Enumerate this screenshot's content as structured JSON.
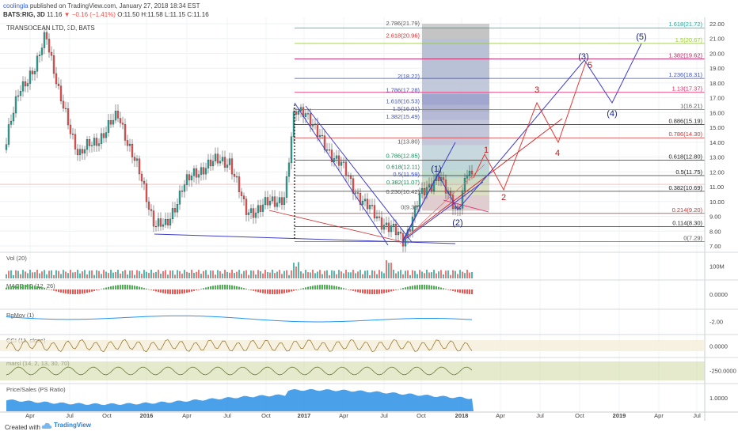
{
  "header": {
    "author": "coolingla",
    "published": "published on TradingView.com, January 27, 2018 18:34 EST",
    "symbol": "BATS:RIG, 3D",
    "last": "11.16",
    "change": "−0.16 (−1.41%)",
    "ohlc": "O:11.50 H:11.58 L:11.15 C:11.16"
  },
  "chart_title": "TRANSOCEAN LTD, 3D, BATS",
  "price_axis": {
    "ticks": [
      "22.00",
      "21.00",
      "20.00",
      "19.00",
      "18.00",
      "17.00",
      "16.00",
      "15.00",
      "14.00",
      "13.00",
      "12.00",
      "11.00",
      "10.00",
      "9.00",
      "8.00",
      "7.00"
    ],
    "badges": [
      {
        "text": "1.618(21.72)",
        "color": "#26a69a"
      },
      {
        "text": "1.5(20.67)",
        "color": "#9acd32"
      },
      {
        "text": "1.382(19.62)",
        "color": "#c2185b"
      },
      {
        "text": "1.236(18.31)",
        "color": "#3f51b5"
      },
      {
        "text": "1.13(17.37)",
        "color": "#e91e63"
      },
      {
        "text": "1(16.21)",
        "color": "#555555"
      },
      {
        "text": "0.886(15.19)",
        "color": "#222222"
      },
      {
        "text": "0.786(14.30)",
        "color": "#d32f2f"
      },
      {
        "text": "0.618(12.80)",
        "color": "#222222"
      },
      {
        "text": "0.5(11.75)",
        "color": "#222222"
      },
      {
        "text": "0.382(10.69)",
        "color": "#222222"
      },
      {
        "text": "0.214(9.20)",
        "color": "#d32f2f"
      },
      {
        "text": "0.114(8.30)",
        "color": "#222222"
      },
      {
        "text": "0(7.29)",
        "color": "#555555"
      }
    ]
  },
  "box_fib_labels": [
    "2.786(21.79)",
    "2.618(20.96)",
    "2(18.22)",
    "1.786(17.28)",
    "1.618(16.53)",
    "1.5(16.01)",
    "1.382(15.49)",
    "1(13.80)",
    "0.786(12.85)",
    "0.618(12.11)",
    "0.5(11.59)",
    "0.382(11.07)",
    "0.236(10.42)",
    "0(9.38)"
  ],
  "waves_blue": [
    "(1)",
    "(2)",
    "(3)",
    "(4)",
    "(5)"
  ],
  "waves_red": [
    "1",
    "2",
    "3",
    "4",
    "5"
  ],
  "indicators": [
    {
      "label": "Vol (20)",
      "axis": "100M"
    },
    {
      "label": "MACD 4C (12, 26)",
      "axis": "0.0000"
    },
    {
      "label": "RgMov (1)",
      "axis": "-2.00"
    },
    {
      "label": "CCI (11, close)",
      "axis": "0.0000"
    },
    {
      "label": "marsi (14, 2, 13, 30, 70)",
      "axis": "-250.0000"
    },
    {
      "label": "Price/Sales (PS Ratio)",
      "axis": "1.0000"
    }
  ],
  "time_axis": [
    "Apr",
    "Jul",
    "Oct",
    "2016",
    "Apr",
    "Jul",
    "Oct",
    "2017",
    "Apr",
    "Jul",
    "Oct",
    "2018",
    "Apr",
    "Jul",
    "Oct",
    "2019",
    "Apr",
    "Jul"
  ],
  "footer": {
    "created": "Created with",
    "brand": "TradingView"
  }
}
